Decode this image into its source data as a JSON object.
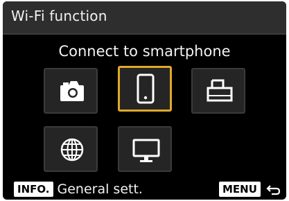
{
  "header": {
    "title": "Wi-Fi function"
  },
  "heading": "Connect to smartphone",
  "tiles": [
    {
      "name": "camera",
      "icon": "camera-icon",
      "selected": false
    },
    {
      "name": "smartphone",
      "icon": "smartphone-icon",
      "selected": true
    },
    {
      "name": "printer",
      "icon": "printer-icon",
      "selected": false
    },
    {
      "name": "web-service",
      "icon": "globe-icon",
      "selected": false
    },
    {
      "name": "computer",
      "icon": "monitor-icon",
      "selected": false
    }
  ],
  "footer": {
    "info_key": "INFO.",
    "info_label": "General sett.",
    "menu_key": "MENU",
    "back_icon": "return-arrow-icon"
  },
  "colors": {
    "accent": "#e0a92a",
    "background": "#000000",
    "titlebar": "#2e2e2e"
  }
}
